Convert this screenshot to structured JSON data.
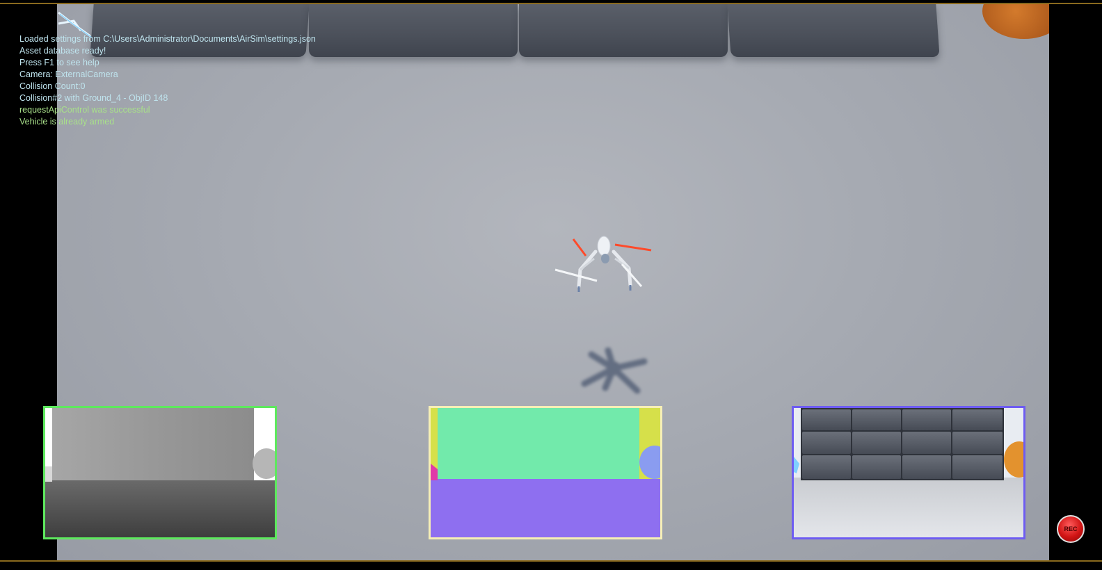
{
  "log": {
    "lines": [
      {
        "text": "Loaded settings from C:\\Users\\Administrator\\Documents\\AirSim\\settings.json",
        "color": "cyan"
      },
      {
        "text": "Asset database ready!",
        "color": "cyan"
      },
      {
        "text": "Press F1 to see help",
        "color": "cyan"
      },
      {
        "text": "Camera: ExternalCamera",
        "color": "cyan"
      },
      {
        "text": "Collision Count:0",
        "color": "cyan"
      },
      {
        "text": "Collision#2 with Ground_4 - ObjID 148",
        "color": "cyan"
      },
      {
        "text": "requestApiControl was successful",
        "color": "green"
      },
      {
        "text": "Vehicle is already armed",
        "color": "green"
      }
    ]
  },
  "subwindows": {
    "depth": {
      "border_color": "#5ee85e"
    },
    "segmentation": {
      "border_color": "#f6efb6"
    },
    "scene": {
      "border_color": "#6e5cf2"
    }
  },
  "record_button": {
    "label": "REC",
    "color": "#d11414"
  },
  "colors": {
    "ground": "#a6aab2",
    "frame_accent": "#8a6a1e",
    "log_cyan": "#bfe4ee",
    "log_green": "#a8e08a"
  }
}
